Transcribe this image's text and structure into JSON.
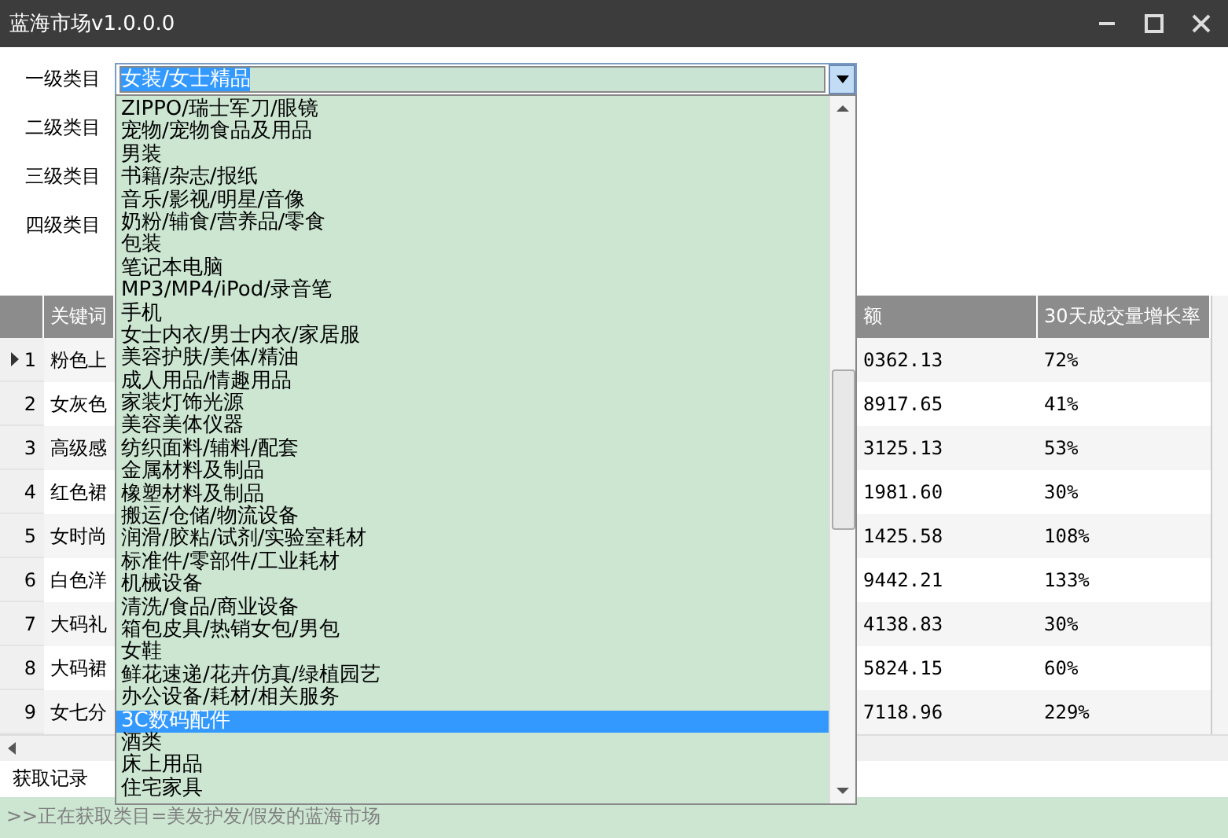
{
  "window": {
    "title": "蓝海市场v1.0.0.0"
  },
  "filters": [
    {
      "label": "一级类目"
    },
    {
      "label": "二级类目"
    },
    {
      "label": "三级类目"
    },
    {
      "label": "四级类目"
    }
  ],
  "combo": {
    "value": "女装/女士精品",
    "expanded": true
  },
  "dropdown_items": [
    {
      "label": "ZIPPO/瑞士军刀/眼镜",
      "selected": false
    },
    {
      "label": "宠物/宠物食品及用品",
      "selected": false
    },
    {
      "label": "男装",
      "selected": false
    },
    {
      "label": "书籍/杂志/报纸",
      "selected": false
    },
    {
      "label": "音乐/影视/明星/音像",
      "selected": false
    },
    {
      "label": "奶粉/辅食/营养品/零食",
      "selected": false
    },
    {
      "label": "包装",
      "selected": false
    },
    {
      "label": "笔记本电脑",
      "selected": false
    },
    {
      "label": "MP3/MP4/iPod/录音笔",
      "selected": false
    },
    {
      "label": "手机",
      "selected": false
    },
    {
      "label": "女士内衣/男士内衣/家居服",
      "selected": false
    },
    {
      "label": "美容护肤/美体/精油",
      "selected": false
    },
    {
      "label": "成人用品/情趣用品",
      "selected": false
    },
    {
      "label": "家装灯饰光源",
      "selected": false
    },
    {
      "label": "美容美体仪器",
      "selected": false
    },
    {
      "label": "纺织面料/辅料/配套",
      "selected": false
    },
    {
      "label": "金属材料及制品",
      "selected": false
    },
    {
      "label": "橡塑材料及制品",
      "selected": false
    },
    {
      "label": "搬运/仓储/物流设备",
      "selected": false
    },
    {
      "label": "润滑/胶粘/试剂/实验室耗材",
      "selected": false
    },
    {
      "label": "标准件/零部件/工业耗材",
      "selected": false
    },
    {
      "label": "机械设备",
      "selected": false
    },
    {
      "label": "清洗/食品/商业设备",
      "selected": false
    },
    {
      "label": "箱包皮具/热销女包/男包",
      "selected": false
    },
    {
      "label": "女鞋",
      "selected": false
    },
    {
      "label": "鲜花速递/花卉仿真/绿植园艺",
      "selected": false
    },
    {
      "label": "办公设备/耗材/相关服务",
      "selected": false
    },
    {
      "label": "3C数码配件",
      "selected": true
    },
    {
      "label": "酒类",
      "selected": false
    },
    {
      "label": "床上用品",
      "selected": false
    },
    {
      "label": "住宅家具",
      "selected": false
    }
  ],
  "table": {
    "columns": [
      "关键词",
      "额",
      "30天成交量增长率"
    ],
    "rows": [
      {
        "index": "1",
        "keyword": "粉色上",
        "amount": "0362.13",
        "growth": "72%",
        "current": true
      },
      {
        "index": "2",
        "keyword": "女灰色",
        "amount": "8917.65",
        "growth": "41%",
        "current": false
      },
      {
        "index": "3",
        "keyword": "高级感",
        "amount": "3125.13",
        "growth": "53%",
        "current": false
      },
      {
        "index": "4",
        "keyword": "红色裙",
        "amount": "1981.60",
        "growth": "30%",
        "current": false
      },
      {
        "index": "5",
        "keyword": "女时尚",
        "amount": "1425.58",
        "growth": "108%",
        "current": false
      },
      {
        "index": "6",
        "keyword": "白色洋",
        "amount": "9442.21",
        "growth": "133%",
        "current": false
      },
      {
        "index": "7",
        "keyword": "大码礼",
        "amount": "4138.83",
        "growth": "30%",
        "current": false
      },
      {
        "index": "8",
        "keyword": "大码裙",
        "amount": "5824.15",
        "growth": "60%",
        "current": false
      },
      {
        "index": "9",
        "keyword": "女七分",
        "amount": "7118.96",
        "growth": "229%",
        "current": false
      }
    ]
  },
  "log": {
    "title": "获取记录",
    "lines": [
      ">>正在获取类目=美发护发/假发的蓝海市场"
    ]
  }
}
